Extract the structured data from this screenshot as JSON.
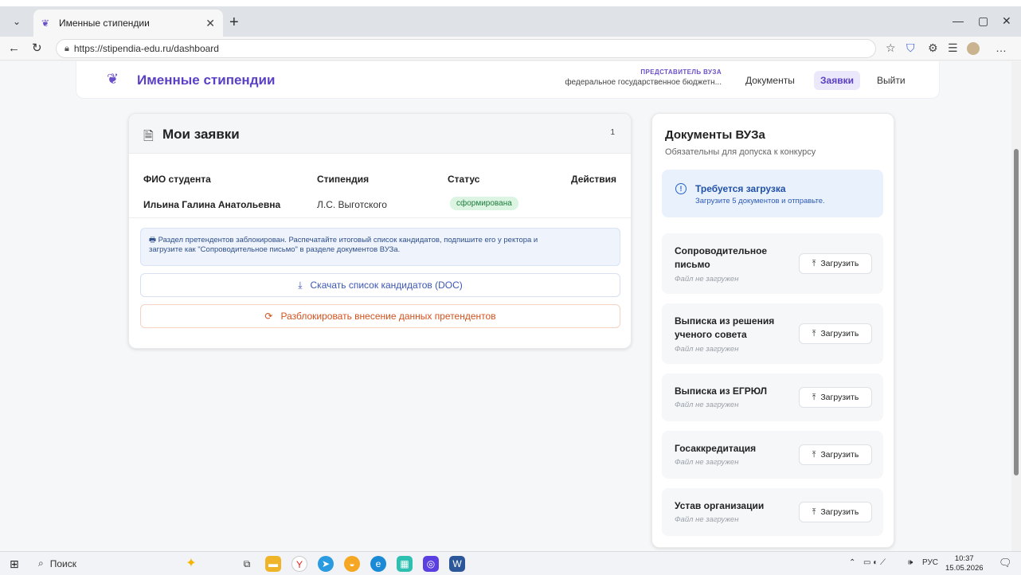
{
  "browser": {
    "tab_title": "Именные стипендии",
    "url": "https://stipendia-edu.ru/dashboard"
  },
  "header": {
    "logo_text": "Именные стипендии",
    "role_label": "ПРЕДСТАВИТЕЛЬ ВУЗА",
    "org_name": "федеральное государственное бюджетн...",
    "nav": {
      "documents": "Документы",
      "applications": "Заявки",
      "logout": "Выйти"
    }
  },
  "applications": {
    "title": "Мои заявки",
    "count": "1",
    "columns": {
      "student": "ФИО студента",
      "scholarship": "Стипендия",
      "status": "Статус",
      "actions": "Действия"
    },
    "rows": [
      {
        "student": "Ильина Галина Анатольевна",
        "scholarship": "Л.С. Выготского",
        "status": "сформирована"
      }
    ],
    "notice_line1": "Раздел претендентов заблокирован. Распечатайте итоговый список кандидатов, подпишите его у ректора и",
    "notice_line2": "загрузите как \"Сопроводительное письмо\" в разделе документов ВУЗа.",
    "download_button": "Скачать список кандидатов (DOC)",
    "unlock_button": "Разблокировать внесение данных претендентов"
  },
  "university_docs": {
    "title": "Документы ВУЗа",
    "subtitle": "Обязательны для допуска к конкурсу",
    "warning_title": "Требуется загрузка",
    "warning_text": "Загрузите 5 документов и отправьте.",
    "upload_label": "Загрузить",
    "items": [
      {
        "name": "Сопроводительное письмо",
        "status": "Файл не загружен"
      },
      {
        "name": "Выписка из решения ученого совета",
        "status": "Файл не загружен"
      },
      {
        "name": "Выписка из ЕГРЮЛ",
        "status": "Файл не загружен"
      },
      {
        "name": "Госаккредитация",
        "status": "Файл не загружен"
      },
      {
        "name": "Устав организации",
        "status": "Файл не загружен"
      }
    ]
  },
  "taskbar": {
    "search_label": "Поиск",
    "lang": "РУС",
    "time": "10:37",
    "date": "15.05.2026"
  },
  "colors": {
    "brand": "#5b3fc4",
    "status_green": "#1d7a3a",
    "warning_blue": "#2150a8",
    "danger_orange": "#d2521f"
  }
}
